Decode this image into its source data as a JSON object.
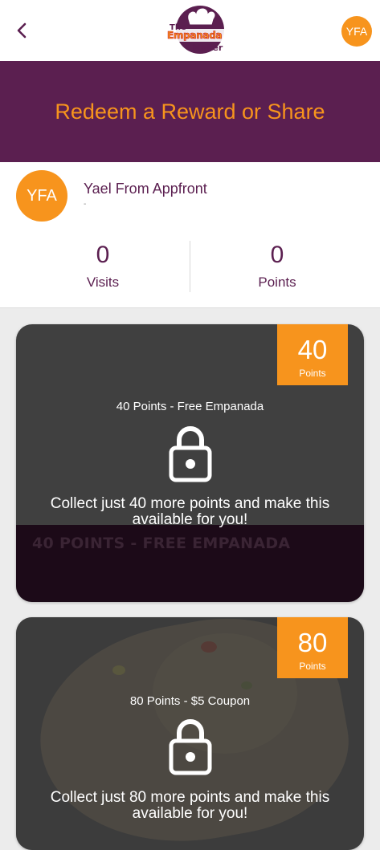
{
  "header": {
    "back_icon": "chevron-left-icon",
    "logo_text": {
      "line1": "The",
      "line2": "Empanada",
      "line3": "Maker"
    },
    "user_initials": "YFA"
  },
  "banner": {
    "title": "Redeem a Reward or Share"
  },
  "profile": {
    "initials": "YFA",
    "name": "Yael From Appfront",
    "subtitle": "-",
    "stats": [
      {
        "value": "0",
        "label": "Visits"
      },
      {
        "value": "0",
        "label": "Points"
      }
    ]
  },
  "rewards": [
    {
      "points": "40",
      "points_label": "Points",
      "title": "40 Points - Free Empanada",
      "image_text": "40 POINTS - FREE EMPANADA",
      "lock_icon": "lock-icon",
      "message": "Collect just 40 more points and make this available for you!"
    },
    {
      "points": "80",
      "points_label": "Points",
      "title": "80 Points - $5 Coupon",
      "lock_icon": "lock-icon",
      "message": "Collect just 80 more points and make this available for you!"
    }
  ],
  "colors": {
    "brand_purple": "#5b1f50",
    "brand_orange": "#f7941d",
    "card_gray": "#404040"
  }
}
